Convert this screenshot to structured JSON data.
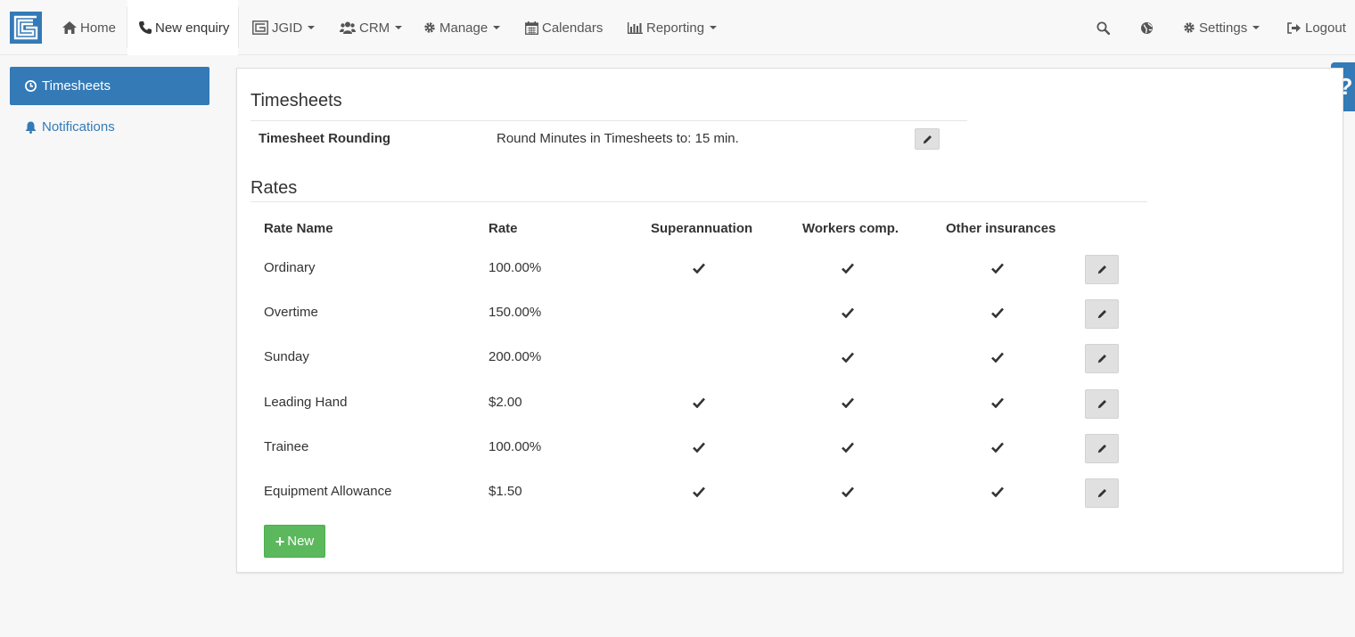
{
  "nav": {
    "home": "Home",
    "new_enquiry": "New enquiry",
    "jgid": "JGID",
    "crm": "CRM",
    "manage": "Manage",
    "calendars": "Calendars",
    "reporting": "Reporting",
    "settings": "Settings",
    "logout": "Logout"
  },
  "sidebar": {
    "items": [
      {
        "label": "Timesheets",
        "icon": "clock-icon",
        "active": true
      },
      {
        "label": "Notifications",
        "icon": "bell-icon",
        "active": false
      }
    ]
  },
  "help": {
    "label": "?"
  },
  "timesheets": {
    "title": "Timesheets",
    "rounding_label": "Timesheet Rounding",
    "rounding_value": "Round Minutes in Timesheets to: 15 min."
  },
  "rates": {
    "title": "Rates",
    "columns": [
      "Rate Name",
      "Rate",
      "Superannuation",
      "Workers comp.",
      "Other insurances"
    ],
    "rows": [
      {
        "name": "Ordinary",
        "rate": "100.00%",
        "super": true,
        "workers": true,
        "other": true
      },
      {
        "name": "Overtime",
        "rate": "150.00%",
        "super": false,
        "workers": true,
        "other": true
      },
      {
        "name": "Sunday",
        "rate": "200.00%",
        "super": false,
        "workers": true,
        "other": true
      },
      {
        "name": "Leading Hand",
        "rate": "$2.00",
        "super": true,
        "workers": true,
        "other": true
      },
      {
        "name": "Trainee",
        "rate": "100.00%",
        "super": true,
        "workers": true,
        "other": true
      },
      {
        "name": "Equipment Allowance",
        "rate": "$1.50",
        "super": true,
        "workers": true,
        "other": true
      }
    ],
    "new_button": "New"
  },
  "colors": {
    "primary": "#337ab7",
    "success": "#5cb85c",
    "button_grey": "#e0e0e0"
  }
}
